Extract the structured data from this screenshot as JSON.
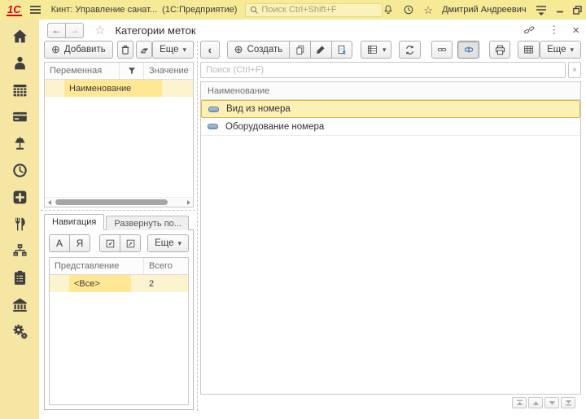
{
  "topbar": {
    "logo_text": "1С",
    "app_title": "Кинт: Управление санат...",
    "app_kind": "(1С:Предприятие)",
    "search_placeholder": "Поиск Ctrl+Shift+F",
    "user_name": "Дмитрий Андреевич"
  },
  "window_controls": {
    "close_glyph": "×"
  },
  "header": {
    "title": "Категории меток",
    "back_glyph": "←",
    "forward_glyph": "→",
    "star_glyph": "☆",
    "menu_glyph": "⋮",
    "close_glyph": "×"
  },
  "glyphs": {
    "plus_circle": "⊕",
    "dropdown": "▾",
    "back_chevron": "‹",
    "star": "☆",
    "search_clear": "×",
    "clear_x": "×"
  },
  "props_panel": {
    "add_label": "Добавить",
    "more_label": "Еще",
    "columns": {
      "name": "Переменная",
      "value": "Значение"
    },
    "rows": [
      {
        "name": "Наименование",
        "value": ""
      }
    ]
  },
  "nav_panel": {
    "tabs": [
      {
        "label": "Навигация"
      },
      {
        "label": "Развернуть по..."
      }
    ],
    "sort_asc_label": "А",
    "sort_desc_label": "Я",
    "more_label": "Еще",
    "columns": {
      "view": "Представление",
      "total": "Всего"
    },
    "rows": [
      {
        "view": "<Все>",
        "total": "2"
      }
    ]
  },
  "list_panel": {
    "create_label": "Создать",
    "more_label": "Еще",
    "search_placeholder": "Поиск (Ctrl+F)",
    "column": "Наименование",
    "rows": [
      {
        "label": "Вид из номера",
        "selected": true
      },
      {
        "label": "Оборудование номера",
        "selected": false
      }
    ]
  },
  "colors": {
    "topbar_bg": "#F7EA96",
    "sidebar_bg": "#F6E6A4",
    "selection_row": "#FCF3CF",
    "selection_cell": "#FFE793",
    "list_selected_bg": "#FDF0B5",
    "list_selected_border": "#D9B44A",
    "logo_red": "#D9001B"
  }
}
